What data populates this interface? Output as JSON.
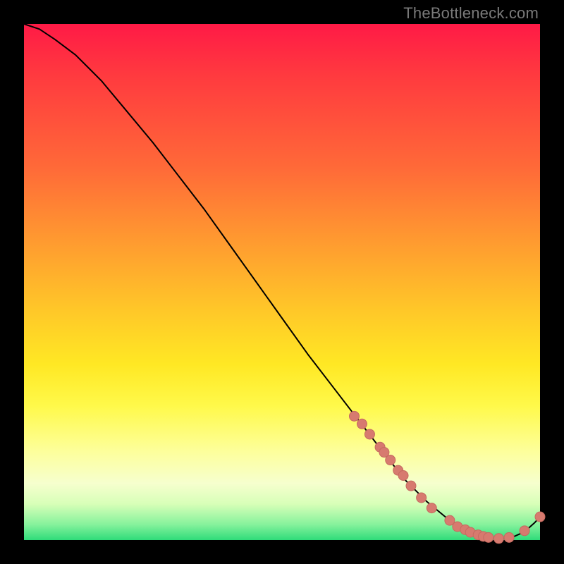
{
  "watermark": "TheBottleneck.com",
  "colors": {
    "curve_stroke": "#000000",
    "marker_fill": "#d77a6f",
    "marker_stroke": "#c56a60"
  },
  "chart_data": {
    "type": "line",
    "title": "",
    "xlabel": "",
    "ylabel": "",
    "xlim": [
      0,
      100
    ],
    "ylim": [
      0,
      100
    ],
    "grid": false,
    "legend": false,
    "series": [
      {
        "name": "bottleneck-curve",
        "x": [
          0,
          3,
          6,
          10,
          15,
          20,
          25,
          30,
          35,
          40,
          45,
          50,
          55,
          60,
          65,
          70,
          74,
          78,
          82,
          85,
          87,
          89,
          91,
          93,
          95,
          97,
          99,
          100
        ],
        "y": [
          100,
          99,
          97,
          94,
          89,
          83,
          77,
          70.5,
          64,
          57,
          50,
          43,
          36,
          29.5,
          23,
          16.5,
          11.5,
          7.5,
          4.2,
          2.2,
          1.2,
          0.6,
          0.3,
          0.3,
          0.7,
          1.6,
          3.4,
          4.5
        ]
      }
    ],
    "markers": {
      "name": "highlighted-points",
      "x": [
        64,
        65.5,
        67,
        69,
        69.8,
        71,
        72.5,
        73.5,
        75,
        77,
        79,
        82.5,
        84,
        85.5,
        86.5,
        88,
        89,
        90,
        92,
        94,
        97,
        100
      ],
      "y": [
        24,
        22.5,
        20.5,
        18,
        17,
        15.5,
        13.5,
        12.5,
        10.5,
        8.2,
        6.2,
        3.8,
        2.6,
        2.0,
        1.5,
        1.0,
        0.7,
        0.5,
        0.3,
        0.5,
        1.8,
        4.5
      ]
    }
  }
}
